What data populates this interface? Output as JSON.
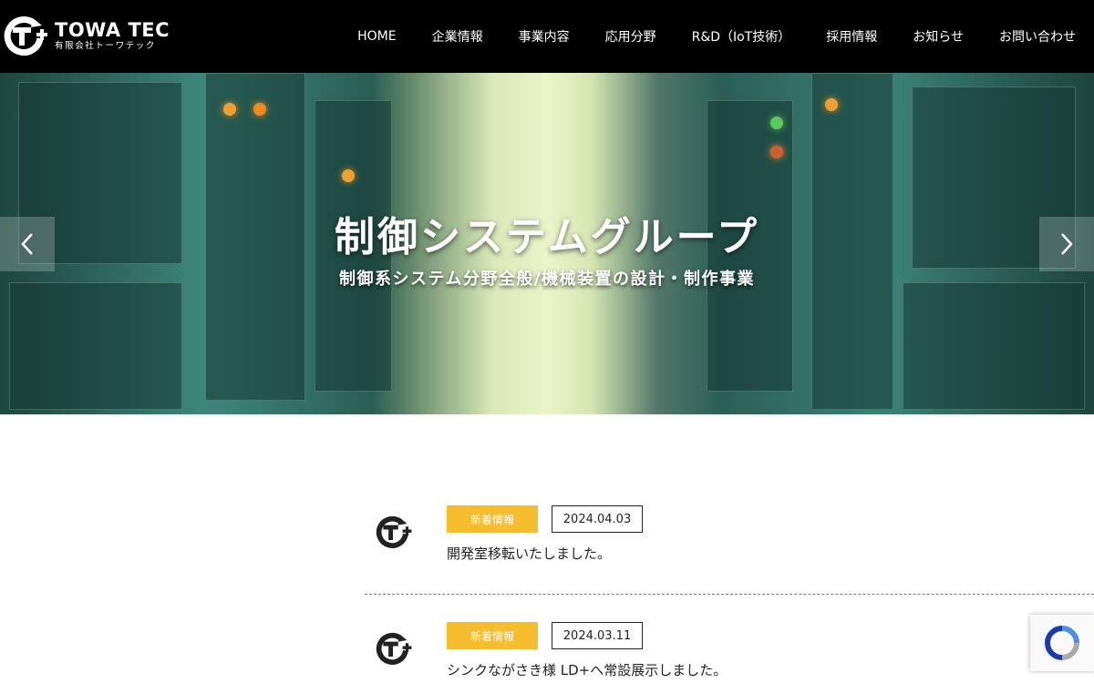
{
  "brand": {
    "name": "TOWA TEC",
    "sub": "有限会社トーワテック",
    "logo_icon": "towatec-logo-icon"
  },
  "nav": {
    "items": [
      {
        "label": "HOME"
      },
      {
        "label": "企業情報"
      },
      {
        "label": "事業内容"
      },
      {
        "label": "応用分野"
      },
      {
        "label": "R&D（IoT技術）"
      },
      {
        "label": "採用情報"
      },
      {
        "label": "お知らせ"
      },
      {
        "label": "お問い合わせ"
      }
    ]
  },
  "hero": {
    "title": "制御システムグループ",
    "subtitle": "制御系システム分野全般/機械装置の設計・制作事業",
    "prev_icon": "chevron-left-icon",
    "next_icon": "chevron-right-icon"
  },
  "news": [
    {
      "tag": "新着情報",
      "date": "2024.04.03",
      "title": "開発室移転いたしました。"
    },
    {
      "tag": "新着情報",
      "date": "2024.03.11",
      "title": "シンクながさき様 LD+へ常設展示しました。"
    }
  ],
  "colors": {
    "header_bg": "#000000",
    "tag_bg": "#f5bd2e",
    "text": "#222222"
  }
}
